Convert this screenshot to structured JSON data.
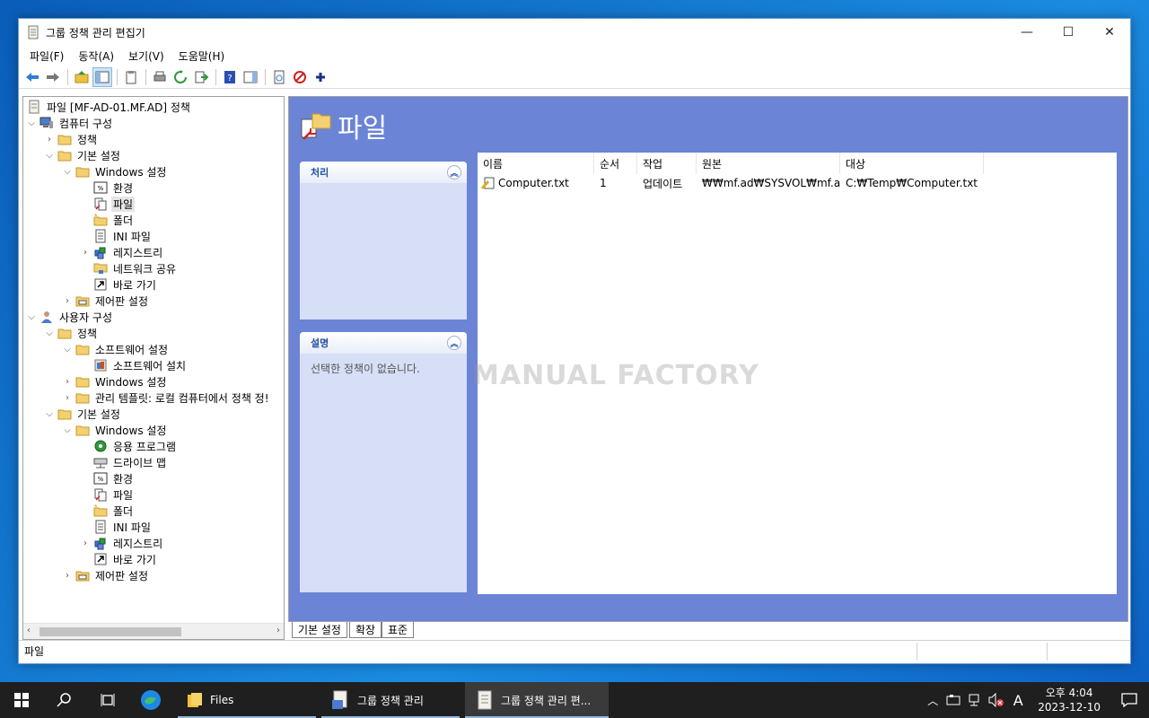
{
  "window": {
    "title": "그룹 정책 관리 편집기",
    "minimize": "—",
    "maximize": "☐",
    "close": "✕"
  },
  "menu": [
    "파일(F)",
    "동작(A)",
    "보기(V)",
    "도움말(H)"
  ],
  "tree": {
    "root": "파일 [MF-AD-01.MF.AD] 정책",
    "computer_config": "컴퓨터 구성",
    "policies": "정책",
    "preferences": "기본 설정",
    "windows_settings": "Windows 설정",
    "environment": "환경",
    "files": "파일",
    "folders": "폴더",
    "ini_files": "INI 파일",
    "registry": "레지스트리",
    "network_shares": "네트워크 공유",
    "shortcuts": "바로 가기",
    "control_panel": "제어판 설정",
    "user_config": "사용자 구성",
    "software_settings": "소프트웨어 설정",
    "software_install": "소프트웨어 설치",
    "admin_templates": "관리 템플릿: 로컬 컴퓨터에서 정책 정!",
    "applications": "응용 프로그램",
    "drive_maps": "드라이브 맵"
  },
  "panel": {
    "heading": "파일",
    "processing_title": "처리",
    "description_title": "설명",
    "description_text": "선택한 정책이 없습니다."
  },
  "list": {
    "columns": [
      "이름",
      "순서",
      "작업",
      "원본",
      "대상"
    ],
    "rows": [
      {
        "name": "Computer.txt",
        "order": "1",
        "action": "업데이트",
        "source": "₩₩mf.ad₩SYSVOL₩mf.a...",
        "target": "C:₩Temp₩Computer.txt"
      }
    ]
  },
  "tabs": [
    "기본 설정",
    "확장",
    "표준"
  ],
  "status": "파일",
  "watermark": "MANUAL FACTORY",
  "taskbar": {
    "files_label": "Files",
    "gpm_label": "그룹 정책 관리",
    "gpme_label": "그룹 정책 관리 편...",
    "time": "오후 4:04",
    "date": "2023-12-10",
    "ime": "A"
  },
  "colors": {
    "panel_bg": "#6c84d6",
    "task_bg": "#d6dff5",
    "taskbar_bg": "#1f1f1f"
  }
}
